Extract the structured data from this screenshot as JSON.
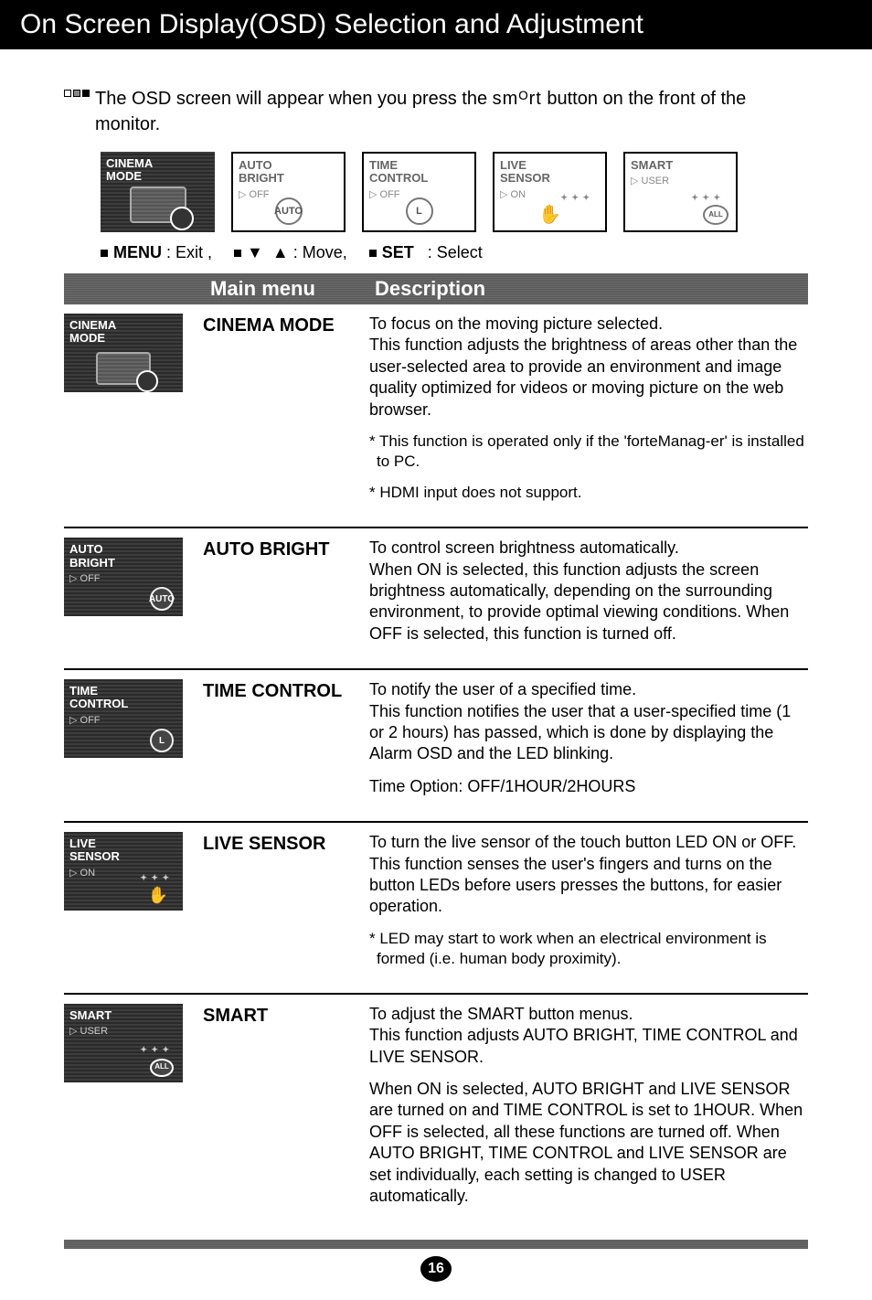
{
  "page_title": "On Screen Display(OSD) Selection and Adjustment",
  "intro": {
    "text_before": "The OSD screen will appear when you press the ",
    "smart_word": "smᴼrt",
    "text_after": " button on the front of the monitor."
  },
  "thumbs": [
    {
      "line1": "CINEMA",
      "line2": "MODE",
      "state": "",
      "variant": "dark",
      "icon": "screen"
    },
    {
      "line1": "AUTO",
      "line2": "BRIGHT",
      "state": "▷ OFF",
      "variant": "light",
      "icon": "auto"
    },
    {
      "line1": "TIME",
      "line2": "CONTROL",
      "state": "▷ OFF",
      "variant": "light",
      "icon": "clock"
    },
    {
      "line1": "LIVE",
      "line2": "SENSOR",
      "state": "▷ ON",
      "variant": "light",
      "icon": "hand"
    },
    {
      "line1": "SMART",
      "line2": "",
      "state": "▷ USER",
      "variant": "light",
      "icon": "all"
    }
  ],
  "nav": {
    "menu_label": "MENU",
    "menu_action": ": Exit ,",
    "move_action": ": Move,",
    "set_label": "SET",
    "set_action": ": Select"
  },
  "header": {
    "main_menu": "Main menu",
    "description": "Description"
  },
  "rows": [
    {
      "icon": {
        "l1": "CINEMA",
        "l2": "MODE",
        "sub": "",
        "glyph": "screen"
      },
      "menu": "CINEMA MODE",
      "desc": [
        "To focus on the moving picture selected.\nThis function adjusts the brightness of areas other than the user-selected area to provide an environment and image quality optimized for videos or moving picture on the web browser."
      ],
      "notes": [
        "* This function is operated only if the 'forteManag-er' is installed to PC.",
        "* HDMI input does not support."
      ]
    },
    {
      "icon": {
        "l1": "AUTO",
        "l2": "BRIGHT",
        "sub": "▷ OFF",
        "glyph": "auto"
      },
      "menu": "AUTO BRIGHT",
      "desc": [
        "To control screen brightness automatically.\nWhen ON is selected, this function adjusts the screen brightness automatically, depending on the surrounding environment, to provide optimal viewing conditions. When OFF is selected, this function is turned off."
      ],
      "notes": []
    },
    {
      "icon": {
        "l1": "TIME",
        "l2": "CONTROL",
        "sub": "▷ OFF",
        "glyph": "clock"
      },
      "menu": "TIME CONTROL",
      "desc": [
        "To notify the user of a specified time.\nThis function notifies the user that a user-specified time (1 or 2 hours) has passed, which is done by displaying the Alarm OSD and the LED blinking.",
        "Time Option: OFF/1HOUR/2HOURS"
      ],
      "notes": []
    },
    {
      "icon": {
        "l1": "LIVE",
        "l2": "SENSOR",
        "sub": "▷ ON",
        "glyph": "hand"
      },
      "menu": "LIVE SENSOR",
      "desc": [
        "To turn the live sensor of the touch button LED ON or OFF. This function senses the user's fingers and turns on the button LEDs before users presses the buttons, for easier operation."
      ],
      "notes": [
        "* LED may start to work when an electrical environment is formed (i.e. human body proximity)."
      ]
    },
    {
      "icon": {
        "l1": "SMART",
        "l2": "",
        "sub": "▷ USER",
        "glyph": "all"
      },
      "menu": "SMART",
      "desc": [
        "To adjust the SMART button menus.\nThis function adjusts AUTO BRIGHT, TIME CONTROL and LIVE SENSOR.",
        "When ON is selected, AUTO BRIGHT and LIVE SENSOR are turned on and TIME CONTROL is set to 1HOUR. When OFF is selected, all these functions are turned off. When AUTO BRIGHT, TIME CONTROL and LIVE SENSOR are set individually, each setting is changed to USER automatically."
      ],
      "notes": []
    }
  ],
  "page_number": "16"
}
